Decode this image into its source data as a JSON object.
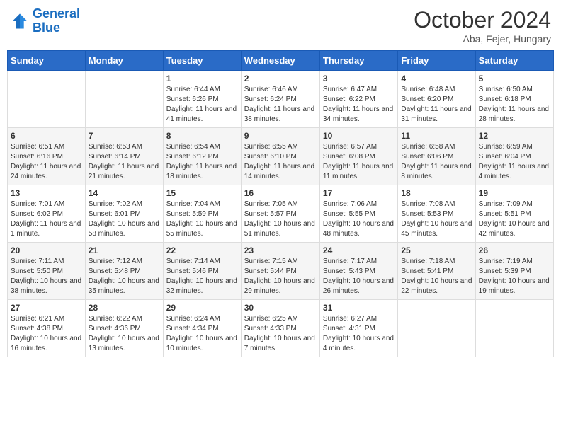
{
  "header": {
    "logo_line1": "General",
    "logo_line2": "Blue",
    "month": "October 2024",
    "location": "Aba, Fejer, Hungary"
  },
  "days_of_week": [
    "Sunday",
    "Monday",
    "Tuesday",
    "Wednesday",
    "Thursday",
    "Friday",
    "Saturday"
  ],
  "weeks": [
    [
      {
        "day": "",
        "sunrise": "",
        "sunset": "",
        "daylight": ""
      },
      {
        "day": "",
        "sunrise": "",
        "sunset": "",
        "daylight": ""
      },
      {
        "day": "1",
        "sunrise": "Sunrise: 6:44 AM",
        "sunset": "Sunset: 6:26 PM",
        "daylight": "Daylight: 11 hours and 41 minutes."
      },
      {
        "day": "2",
        "sunrise": "Sunrise: 6:46 AM",
        "sunset": "Sunset: 6:24 PM",
        "daylight": "Daylight: 11 hours and 38 minutes."
      },
      {
        "day": "3",
        "sunrise": "Sunrise: 6:47 AM",
        "sunset": "Sunset: 6:22 PM",
        "daylight": "Daylight: 11 hours and 34 minutes."
      },
      {
        "day": "4",
        "sunrise": "Sunrise: 6:48 AM",
        "sunset": "Sunset: 6:20 PM",
        "daylight": "Daylight: 11 hours and 31 minutes."
      },
      {
        "day": "5",
        "sunrise": "Sunrise: 6:50 AM",
        "sunset": "Sunset: 6:18 PM",
        "daylight": "Daylight: 11 hours and 28 minutes."
      }
    ],
    [
      {
        "day": "6",
        "sunrise": "Sunrise: 6:51 AM",
        "sunset": "Sunset: 6:16 PM",
        "daylight": "Daylight: 11 hours and 24 minutes."
      },
      {
        "day": "7",
        "sunrise": "Sunrise: 6:53 AM",
        "sunset": "Sunset: 6:14 PM",
        "daylight": "Daylight: 11 hours and 21 minutes."
      },
      {
        "day": "8",
        "sunrise": "Sunrise: 6:54 AM",
        "sunset": "Sunset: 6:12 PM",
        "daylight": "Daylight: 11 hours and 18 minutes."
      },
      {
        "day": "9",
        "sunrise": "Sunrise: 6:55 AM",
        "sunset": "Sunset: 6:10 PM",
        "daylight": "Daylight: 11 hours and 14 minutes."
      },
      {
        "day": "10",
        "sunrise": "Sunrise: 6:57 AM",
        "sunset": "Sunset: 6:08 PM",
        "daylight": "Daylight: 11 hours and 11 minutes."
      },
      {
        "day": "11",
        "sunrise": "Sunrise: 6:58 AM",
        "sunset": "Sunset: 6:06 PM",
        "daylight": "Daylight: 11 hours and 8 minutes."
      },
      {
        "day": "12",
        "sunrise": "Sunrise: 6:59 AM",
        "sunset": "Sunset: 6:04 PM",
        "daylight": "Daylight: 11 hours and 4 minutes."
      }
    ],
    [
      {
        "day": "13",
        "sunrise": "Sunrise: 7:01 AM",
        "sunset": "Sunset: 6:02 PM",
        "daylight": "Daylight: 11 hours and 1 minute."
      },
      {
        "day": "14",
        "sunrise": "Sunrise: 7:02 AM",
        "sunset": "Sunset: 6:01 PM",
        "daylight": "Daylight: 10 hours and 58 minutes."
      },
      {
        "day": "15",
        "sunrise": "Sunrise: 7:04 AM",
        "sunset": "Sunset: 5:59 PM",
        "daylight": "Daylight: 10 hours and 55 minutes."
      },
      {
        "day": "16",
        "sunrise": "Sunrise: 7:05 AM",
        "sunset": "Sunset: 5:57 PM",
        "daylight": "Daylight: 10 hours and 51 minutes."
      },
      {
        "day": "17",
        "sunrise": "Sunrise: 7:06 AM",
        "sunset": "Sunset: 5:55 PM",
        "daylight": "Daylight: 10 hours and 48 minutes."
      },
      {
        "day": "18",
        "sunrise": "Sunrise: 7:08 AM",
        "sunset": "Sunset: 5:53 PM",
        "daylight": "Daylight: 10 hours and 45 minutes."
      },
      {
        "day": "19",
        "sunrise": "Sunrise: 7:09 AM",
        "sunset": "Sunset: 5:51 PM",
        "daylight": "Daylight: 10 hours and 42 minutes."
      }
    ],
    [
      {
        "day": "20",
        "sunrise": "Sunrise: 7:11 AM",
        "sunset": "Sunset: 5:50 PM",
        "daylight": "Daylight: 10 hours and 38 minutes."
      },
      {
        "day": "21",
        "sunrise": "Sunrise: 7:12 AM",
        "sunset": "Sunset: 5:48 PM",
        "daylight": "Daylight: 10 hours and 35 minutes."
      },
      {
        "day": "22",
        "sunrise": "Sunrise: 7:14 AM",
        "sunset": "Sunset: 5:46 PM",
        "daylight": "Daylight: 10 hours and 32 minutes."
      },
      {
        "day": "23",
        "sunrise": "Sunrise: 7:15 AM",
        "sunset": "Sunset: 5:44 PM",
        "daylight": "Daylight: 10 hours and 29 minutes."
      },
      {
        "day": "24",
        "sunrise": "Sunrise: 7:17 AM",
        "sunset": "Sunset: 5:43 PM",
        "daylight": "Daylight: 10 hours and 26 minutes."
      },
      {
        "day": "25",
        "sunrise": "Sunrise: 7:18 AM",
        "sunset": "Sunset: 5:41 PM",
        "daylight": "Daylight: 10 hours and 22 minutes."
      },
      {
        "day": "26",
        "sunrise": "Sunrise: 7:19 AM",
        "sunset": "Sunset: 5:39 PM",
        "daylight": "Daylight: 10 hours and 19 minutes."
      }
    ],
    [
      {
        "day": "27",
        "sunrise": "Sunrise: 6:21 AM",
        "sunset": "Sunset: 4:38 PM",
        "daylight": "Daylight: 10 hours and 16 minutes."
      },
      {
        "day": "28",
        "sunrise": "Sunrise: 6:22 AM",
        "sunset": "Sunset: 4:36 PM",
        "daylight": "Daylight: 10 hours and 13 minutes."
      },
      {
        "day": "29",
        "sunrise": "Sunrise: 6:24 AM",
        "sunset": "Sunset: 4:34 PM",
        "daylight": "Daylight: 10 hours and 10 minutes."
      },
      {
        "day": "30",
        "sunrise": "Sunrise: 6:25 AM",
        "sunset": "Sunset: 4:33 PM",
        "daylight": "Daylight: 10 hours and 7 minutes."
      },
      {
        "day": "31",
        "sunrise": "Sunrise: 6:27 AM",
        "sunset": "Sunset: 4:31 PM",
        "daylight": "Daylight: 10 hours and 4 minutes."
      },
      {
        "day": "",
        "sunrise": "",
        "sunset": "",
        "daylight": ""
      },
      {
        "day": "",
        "sunrise": "",
        "sunset": "",
        "daylight": ""
      }
    ]
  ]
}
